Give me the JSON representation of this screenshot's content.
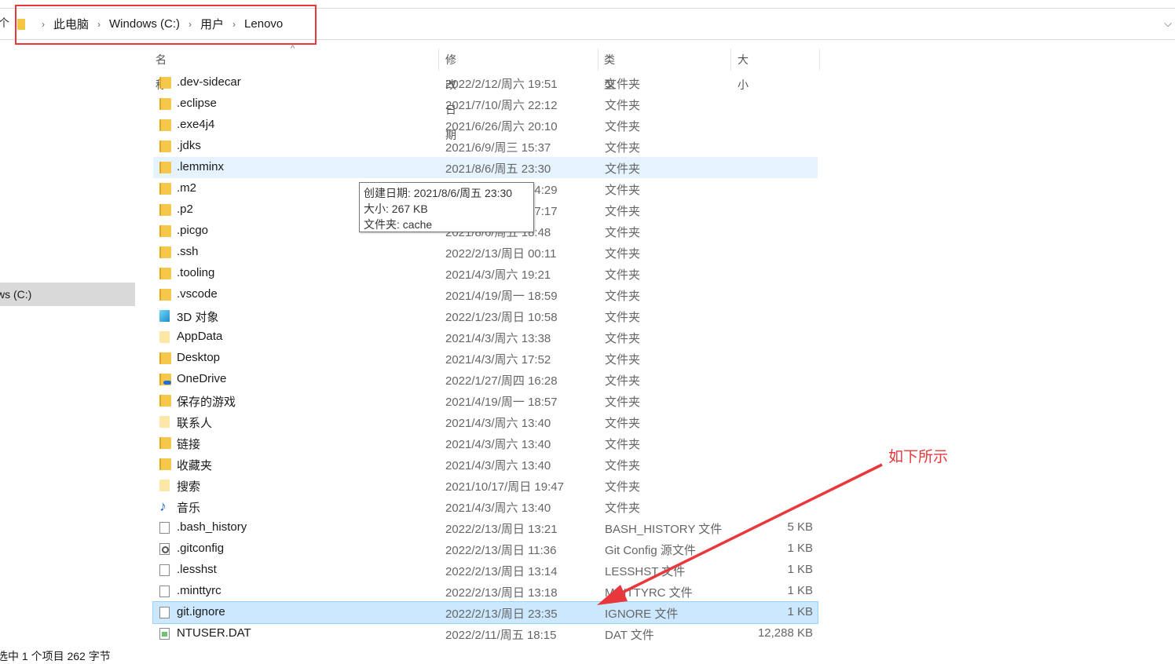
{
  "breadcrumb": [
    "此电脑",
    "Windows (C:)",
    "用户",
    "Lenovo"
  ],
  "nav": {
    "items": [
      {
        "label": "ws (C:)",
        "selected": true
      },
      {
        "label": ")",
        "selected": false
      },
      {
        "label": ")",
        "selected": false
      }
    ]
  },
  "columns": {
    "name": "名称",
    "date": "修改日期",
    "type": "类型",
    "size": "大小"
  },
  "files": [
    {
      "name": ".dev-sidecar",
      "date": "2022/2/12/周六 19:51",
      "type": "文件夹",
      "size": "",
      "icon": "folder-icon"
    },
    {
      "name": ".eclipse",
      "date": "2021/7/10/周六 22:12",
      "type": "文件夹",
      "size": "",
      "icon": "folder-icon"
    },
    {
      "name": ".exe4j4",
      "date": "2021/6/26/周六 20:10",
      "type": "文件夹",
      "size": "",
      "icon": "folder-icon"
    },
    {
      "name": ".jdks",
      "date": "2021/6/9/周三 15:37",
      "type": "文件夹",
      "size": "",
      "icon": "folder-icon"
    },
    {
      "name": ".lemminx",
      "date": "2021/8/6/周五 23:30",
      "type": "文件夹",
      "size": "",
      "icon": "folder-icon",
      "state": "hover"
    },
    {
      "name": ".m2",
      "date": "2021/7/21/周三 14:29",
      "type": "文件夹",
      "size": "",
      "icon": "folder-icon"
    },
    {
      "name": ".p2",
      "date": "2021/7/10/周六 17:17",
      "type": "文件夹",
      "size": "",
      "icon": "folder-icon"
    },
    {
      "name": ".picgo",
      "date": "2021/8/6/周五 18:48",
      "type": "文件夹",
      "size": "",
      "icon": "folder-icon"
    },
    {
      "name": ".ssh",
      "date": "2022/2/13/周日 00:11",
      "type": "文件夹",
      "size": "",
      "icon": "folder-icon"
    },
    {
      "name": ".tooling",
      "date": "2021/4/3/周六 19:21",
      "type": "文件夹",
      "size": "",
      "icon": "folder-icon"
    },
    {
      "name": ".vscode",
      "date": "2021/4/19/周一 18:59",
      "type": "文件夹",
      "size": "",
      "icon": "folder-icon"
    },
    {
      "name": "3D 对象",
      "date": "2022/1/23/周日 10:58",
      "type": "文件夹",
      "size": "",
      "icon": "3d-objects-icon"
    },
    {
      "name": "AppData",
      "date": "2021/4/3/周六 13:38",
      "type": "文件夹",
      "size": "",
      "icon": "hidden-folder-icon"
    },
    {
      "name": "Desktop",
      "date": "2021/4/3/周六 17:52",
      "type": "文件夹",
      "size": "",
      "icon": "folder-icon"
    },
    {
      "name": "OneDrive",
      "date": "2022/1/27/周四 16:28",
      "type": "文件夹",
      "size": "",
      "icon": "onedrive-folder-icon"
    },
    {
      "name": "保存的游戏",
      "date": "2021/4/19/周一 18:57",
      "type": "文件夹",
      "size": "",
      "icon": "saved-games-icon"
    },
    {
      "name": "联系人",
      "date": "2021/4/3/周六 13:40",
      "type": "文件夹",
      "size": "",
      "icon": "contacts-icon"
    },
    {
      "name": "链接",
      "date": "2021/4/3/周六 13:40",
      "type": "文件夹",
      "size": "",
      "icon": "links-icon"
    },
    {
      "name": "收藏夹",
      "date": "2021/4/3/周六 13:40",
      "type": "文件夹",
      "size": "",
      "icon": "favorites-icon"
    },
    {
      "name": "搜索",
      "date": "2021/10/17/周日 19:47",
      "type": "文件夹",
      "size": "",
      "icon": "searches-icon"
    },
    {
      "name": "音乐",
      "date": "2021/4/3/周六 13:40",
      "type": "文件夹",
      "size": "",
      "icon": "music-icon"
    },
    {
      "name": ".bash_history",
      "date": "2022/2/13/周日 13:21",
      "type": "BASH_HISTORY 文件",
      "size": "5 KB",
      "icon": "file-icon"
    },
    {
      "name": ".gitconfig",
      "date": "2022/2/13/周日 11:36",
      "type": "Git Config 源文件",
      "size": "1 KB",
      "icon": "config-file-icon"
    },
    {
      "name": ".lesshst",
      "date": "2022/2/13/周日 13:14",
      "type": "LESSHST 文件",
      "size": "1 KB",
      "icon": "file-icon"
    },
    {
      "name": ".minttyrc",
      "date": "2022/2/13/周日 13:18",
      "type": "MINTTYRC 文件",
      "size": "1 KB",
      "icon": "file-icon"
    },
    {
      "name": "git.ignore",
      "date": "2022/2/13/周日 23:35",
      "type": "IGNORE 文件",
      "size": "1 KB",
      "icon": "file-icon",
      "state": "selected"
    },
    {
      "name": "NTUSER.DAT",
      "date": "2022/2/11/周五 18:15",
      "type": "DAT 文件",
      "size": "12,288 KB",
      "icon": "dat-file-icon"
    }
  ],
  "tooltip": {
    "line1": "创建日期: 2021/8/6/周五 23:30",
    "line2": "大小: 267 KB",
    "line3": "文件夹: cache"
  },
  "annotation": {
    "text": "如下所示",
    "color": "#e8383c"
  },
  "status": "选中 1 个项目  262 字节",
  "colors": {
    "accent_red": "#e8383c",
    "selection": "#cce8ff",
    "hover": "#e5f3ff"
  }
}
